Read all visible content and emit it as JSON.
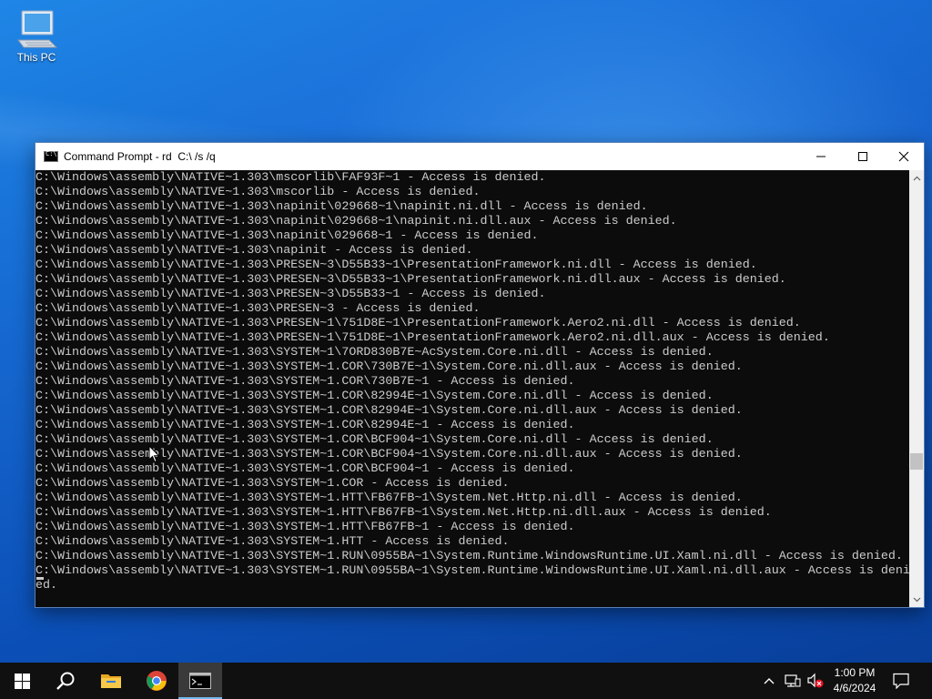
{
  "desktop": {
    "icons": [
      {
        "label": "This PC",
        "icon": "computer-icon"
      }
    ]
  },
  "window": {
    "title": "Command Prompt - rd  C:\\ /s /q",
    "icon": "cmd-icon",
    "controls": {
      "minimize": "minimize-icon",
      "maximize": "maximize-icon",
      "close": "close-icon"
    }
  },
  "console": {
    "lines": [
      "C:\\Windows\\assembly\\NATIVE~1.303\\mscorlib\\FAF93F~1 - Access is denied.",
      "C:\\Windows\\assembly\\NATIVE~1.303\\mscorlib - Access is denied.",
      "C:\\Windows\\assembly\\NATIVE~1.303\\napinit\\029668~1\\napinit.ni.dll - Access is denied.",
      "C:\\Windows\\assembly\\NATIVE~1.303\\napinit\\029668~1\\napinit.ni.dll.aux - Access is denied.",
      "C:\\Windows\\assembly\\NATIVE~1.303\\napinit\\029668~1 - Access is denied.",
      "C:\\Windows\\assembly\\NATIVE~1.303\\napinit - Access is denied.",
      "C:\\Windows\\assembly\\NATIVE~1.303\\PRESEN~3\\D55B33~1\\PresentationFramework.ni.dll - Access is denied.",
      "C:\\Windows\\assembly\\NATIVE~1.303\\PRESEN~3\\D55B33~1\\PresentationFramework.ni.dll.aux - Access is denied.",
      "C:\\Windows\\assembly\\NATIVE~1.303\\PRESEN~3\\D55B33~1 - Access is denied.",
      "C:\\Windows\\assembly\\NATIVE~1.303\\PRESEN~3 - Access is denied.",
      "C:\\Windows\\assembly\\NATIVE~1.303\\PRESEN~1\\751D8E~1\\PresentationFramework.Aero2.ni.dll - Access is denied.",
      "C:\\Windows\\assembly\\NATIVE~1.303\\PRESEN~1\\751D8E~1\\PresentationFramework.Aero2.ni.dll.aux - Access is denied.",
      "C:\\Windows\\assembly\\NATIVE~1.303\\SYSTEM~1\\7ORD830B7E~AcSystem.Core.ni.dll - Access is denied.",
      "C:\\Windows\\assembly\\NATIVE~1.303\\SYSTEM~1.COR\\730B7E~1\\System.Core.ni.dll.aux - Access is denied.",
      "C:\\Windows\\assembly\\NATIVE~1.303\\SYSTEM~1.COR\\730B7E~1 - Access is denied.",
      "C:\\Windows\\assembly\\NATIVE~1.303\\SYSTEM~1.COR\\82994E~1\\System.Core.ni.dll - Access is denied.",
      "C:\\Windows\\assembly\\NATIVE~1.303\\SYSTEM~1.COR\\82994E~1\\System.Core.ni.dll.aux - Access is denied.",
      "C:\\Windows\\assembly\\NATIVE~1.303\\SYSTEM~1.COR\\82994E~1 - Access is denied.",
      "C:\\Windows\\assembly\\NATIVE~1.303\\SYSTEM~1.COR\\BCF904~1\\System.Core.ni.dll - Access is denied.",
      "C:\\Windows\\assembly\\NATIVE~1.303\\SYSTEM~1.COR\\BCF904~1\\System.Core.ni.dll.aux - Access is denied.",
      "C:\\Windows\\assembly\\NATIVE~1.303\\SYSTEM~1.COR\\BCF904~1 - Access is denied.",
      "C:\\Windows\\assembly\\NATIVE~1.303\\SYSTEM~1.COR - Access is denied.",
      "C:\\Windows\\assembly\\NATIVE~1.303\\SYSTEM~1.HTT\\FB67FB~1\\System.Net.Http.ni.dll - Access is denied.",
      "C:\\Windows\\assembly\\NATIVE~1.303\\SYSTEM~1.HTT\\FB67FB~1\\System.Net.Http.ni.dll.aux - Access is denied.",
      "C:\\Windows\\assembly\\NATIVE~1.303\\SYSTEM~1.HTT\\FB67FB~1 - Access is denied.",
      "C:\\Windows\\assembly\\NATIVE~1.303\\SYSTEM~1.HTT - Access is denied.",
      "C:\\Windows\\assembly\\NATIVE~1.303\\SYSTEM~1.RUN\\0955BA~1\\System.Runtime.WindowsRuntime.UI.Xaml.ni.dll - Access is denied.",
      "C:\\Windows\\assembly\\NATIVE~1.303\\SYSTEM~1.RUN\\0955BA~1\\System.Runtime.WindowsRuntime.UI.Xaml.ni.dll.aux - Access is deni",
      "ed."
    ]
  },
  "taskbar": {
    "start_icon": "windows-logo-icon",
    "search_icon": "search-icon",
    "apps": [
      {
        "name": "File Explorer",
        "icon": "folder-icon"
      },
      {
        "name": "Google Chrome",
        "icon": "chrome-icon"
      },
      {
        "name": "Command Prompt",
        "icon": "cmd-icon",
        "active": true
      }
    ],
    "tray": {
      "icons": [
        "chevron-up-icon",
        "network-icon",
        "volume-muted-icon"
      ],
      "time": "1:00 PM",
      "date": "4/6/2024",
      "notification_icon": "notification-icon"
    }
  },
  "colors": {
    "console_bg": "#0c0c0c",
    "console_text": "#cccccc",
    "taskbar_bg": "#101010",
    "accent": "#76b9ed"
  }
}
